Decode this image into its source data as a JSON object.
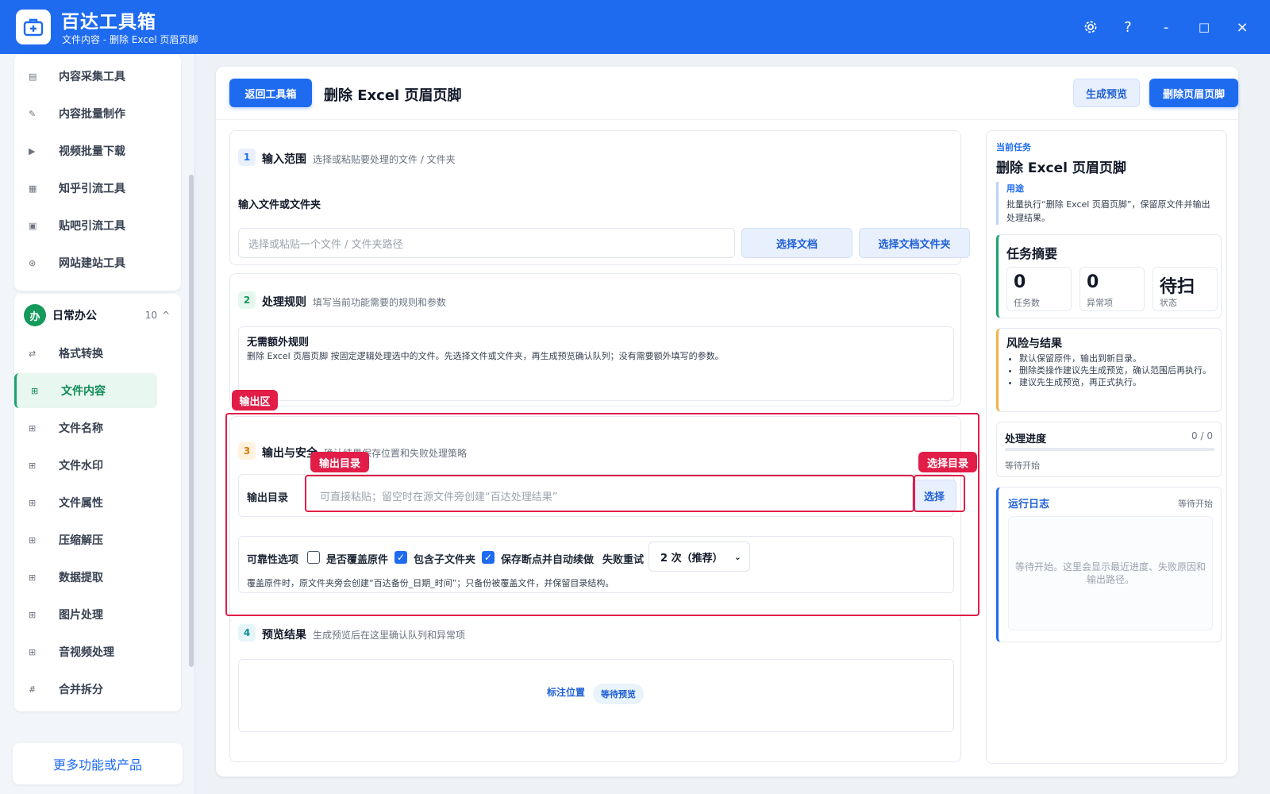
{
  "app": {
    "title": "百达工具箱",
    "subtitle": "文件内容 - 删除 Excel 页眉页脚"
  },
  "window_controls": {
    "settings_icon": "gear-icon",
    "help": "?",
    "minimize": "-",
    "maximize": "□",
    "close": "×"
  },
  "sidebar": {
    "top_items": [
      {
        "label": "内容采集工具",
        "icon": "document-icon"
      },
      {
        "label": "内容批量制作",
        "icon": "pen-icon"
      },
      {
        "label": "视频批量下载",
        "icon": "video-icon"
      },
      {
        "label": "知乎引流工具",
        "icon": "zhihu-icon"
      },
      {
        "label": "贴吧引流工具",
        "icon": "chat-icon"
      },
      {
        "label": "网站建站工具",
        "icon": "globe-icon"
      }
    ],
    "group": {
      "avatar": "办",
      "name": "日常办公",
      "count": "10",
      "caret": "^"
    },
    "group_items": [
      {
        "label": "格式转换",
        "icon": "swap-icon"
      },
      {
        "label": "文件内容",
        "icon": "grid-icon"
      },
      {
        "label": "文件名称",
        "icon": "grid-icon"
      },
      {
        "label": "文件水印",
        "icon": "grid-icon"
      },
      {
        "label": "文件属性",
        "icon": "grid-icon"
      },
      {
        "label": "压缩解压",
        "icon": "grid-icon"
      },
      {
        "label": "数据提取",
        "icon": "grid-icon"
      },
      {
        "label": "图片处理",
        "icon": "grid-icon"
      },
      {
        "label": "音视频处理",
        "icon": "grid-icon"
      },
      {
        "label": "合并拆分",
        "icon": "hash-icon"
      }
    ],
    "active_item": "文件内容",
    "more": "更多功能或产品"
  },
  "header": {
    "back": "返回工具箱",
    "title": "删除 Excel 页眉页脚",
    "preview_btn": "生成预览",
    "run_btn": "删除页眉页脚"
  },
  "section1": {
    "num": "1",
    "title": "输入范围",
    "desc": "选择或粘贴要处理的文件 / 文件夹",
    "field_label": "输入文件或文件夹",
    "placeholder": "选择或粘贴一个文件 / 文件夹路径",
    "btn_doc": "选择文档",
    "btn_folder": "选择文档文件夹"
  },
  "section2": {
    "num": "2",
    "title": "处理规则",
    "desc": "填写当前功能需要的规则和参数",
    "rule_title": "无需额外规则",
    "rule_desc": "删除 Excel 页眉页脚 按固定逻辑处理选中的文件。先选择文件或文件夹，再生成预览确认队列；没有需要额外填写的参数。"
  },
  "section3": {
    "num": "3",
    "title": "输出与安全",
    "desc": "确认结果保存位置和失败处理策略",
    "output_label": "输出目录",
    "output_placeholder": "可直接粘贴；留空时在源文件旁创建“百达处理结果”",
    "choose_btn": "选择",
    "reliability_label": "可靠性选项",
    "opt_overwrite": "是否覆盖原件",
    "opt_subfolder": "包含子文件夹",
    "opt_resume": "保存断点并自动续做",
    "retry_label": "失败重试",
    "retry_value": "2 次（推荐）",
    "note": "覆盖原件时，原文件夹旁会创建“百达备份_日期_时间”；只备份被覆盖文件，并保留目录结构。",
    "overwrite_checked": false,
    "subfolder_checked": true,
    "resume_checked": true
  },
  "annotations": {
    "output_area": "输出区",
    "output_dir": "输出目录",
    "choose_dir": "选择目录"
  },
  "section4": {
    "num": "4",
    "title": "预览结果",
    "desc": "生成预览后在这里确认队列和异常项",
    "mark_label": "标注位置",
    "badge": "等待预览"
  },
  "right": {
    "current_task_label": "当前任务",
    "task_title": "删除 Excel 页眉页脚",
    "usage_label": "用途",
    "usage_text": "批量执行“删除 Excel 页眉页脚”，保留原文件并输出处理结果。",
    "summary_title": "任务摘要",
    "stats": [
      {
        "value": "0",
        "label": "任务数"
      },
      {
        "value": "0",
        "label": "异常项"
      },
      {
        "value": "待扫",
        "label": "状态"
      }
    ],
    "risk_title": "风险与结果",
    "risks": [
      "默认保留原件，输出到新目录。",
      "删除类操作建议先生成预览，确认范围后再执行。",
      "建议先生成预览，再正式执行。"
    ],
    "progress_title": "处理进度",
    "progress_value": "0 / 0",
    "progress_fraction": 0,
    "progress_status": "等待开始",
    "log_title": "运行日志",
    "log_status": "等待开始",
    "log_placeholder": "等待开始。这里会显示最近进度、失败原因和输出路径。"
  },
  "colors": {
    "brand": "#1f6bf0",
    "active_green": "#1aa36b",
    "annotation_red": "#e11d48"
  }
}
